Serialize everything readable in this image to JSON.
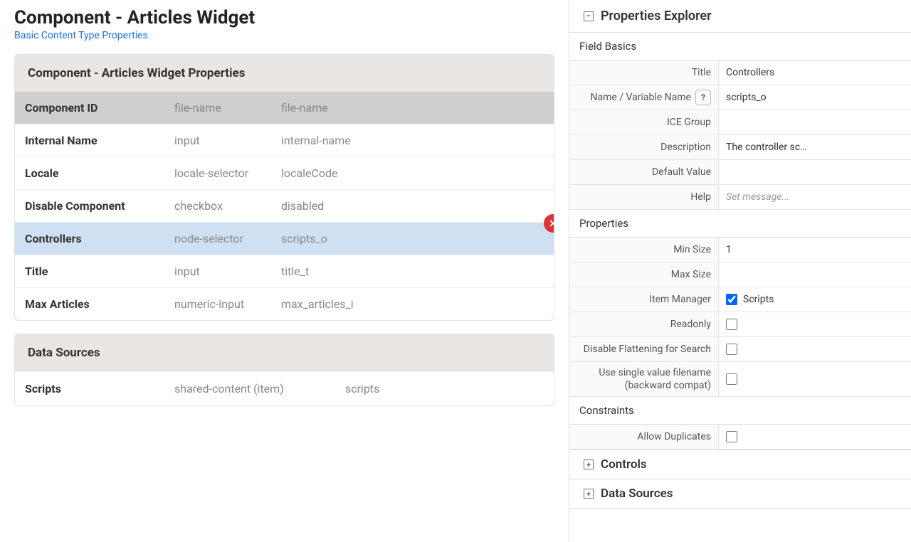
{
  "header": {
    "title": "Component - Articles Widget",
    "link": "Basic Content Type Properties"
  },
  "properties_card": {
    "title": "Component - Articles Widget Properties",
    "rows": [
      {
        "name": "Component ID",
        "type": "file-name",
        "var": "file-name",
        "header": true
      },
      {
        "name": "Internal Name",
        "type": "input",
        "var": "internal-name"
      },
      {
        "name": "Locale",
        "type": "locale-selector",
        "var": "localeCode"
      },
      {
        "name": "Disable Component",
        "type": "checkbox",
        "var": "disabled"
      },
      {
        "name": "Controllers",
        "type": "node-selector",
        "var": "scripts_o",
        "selected": true
      },
      {
        "name": "Title",
        "type": "input",
        "var": "title_t"
      },
      {
        "name": "Max Articles",
        "type": "numeric-input",
        "var": "max_articles_i"
      }
    ]
  },
  "datasources_card": {
    "title": "Data Sources",
    "rows": [
      {
        "name": "Scripts",
        "type": "shared-content (item)",
        "var": "scripts"
      }
    ]
  },
  "explorer": {
    "title": "Properties Explorer",
    "sections": {
      "field_basics": {
        "title": "Field Basics",
        "rows": {
          "title": {
            "label": "Title",
            "value": "Controllers"
          },
          "name": {
            "label": "Name / Variable Name",
            "value": "scripts_o",
            "help": true
          },
          "ice_group": {
            "label": "ICE Group",
            "value": ""
          },
          "description": {
            "label": "Description",
            "value": "The controller sc…"
          },
          "default_value": {
            "label": "Default Value",
            "value": ""
          },
          "help": {
            "label": "Help",
            "placeholder": "Set message..."
          }
        }
      },
      "properties": {
        "title": "Properties",
        "rows": {
          "min_size": {
            "label": "Min Size",
            "value": "1"
          },
          "max_size": {
            "label": "Max Size",
            "value": ""
          },
          "item_manager": {
            "label": "Item Manager",
            "checked": true,
            "text": "Scripts"
          },
          "readonly": {
            "label": "Readonly",
            "checked": false
          },
          "disable_flattening": {
            "label": "Disable Flattening for Search",
            "checked": false
          },
          "single_value": {
            "label": "Use single value filename (backward compat)",
            "checked": false
          }
        }
      },
      "constraints": {
        "title": "Constraints",
        "rows": {
          "allow_duplicates": {
            "label": "Allow Duplicates",
            "checked": false
          }
        }
      }
    },
    "collapsed": {
      "controls": "Controls",
      "data_sources": "Data Sources"
    }
  }
}
